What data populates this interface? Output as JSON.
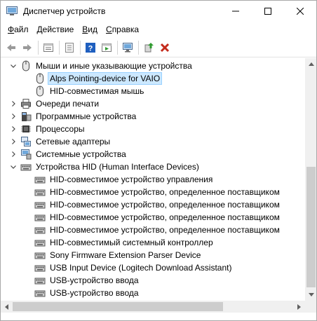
{
  "window": {
    "title": "Диспетчер устройств",
    "icon": "device-manager-icon"
  },
  "menu": [
    "Файл",
    "Действие",
    "Вид",
    "Справка"
  ],
  "toolbar": [
    "back-icon",
    "forward-icon",
    "properties-icon",
    "grid-icon",
    "help-icon",
    "run-icon",
    "monitor-icon",
    "update-driver-icon",
    "remove-device-icon"
  ],
  "tree": [
    {
      "label": "Мыши и иные указывающие устройства",
      "level": 1,
      "expanded": true,
      "icon": "mouse-icon"
    },
    {
      "label": "Alps Pointing-device for VAIO",
      "level": 2,
      "icon": "mouse-icon",
      "selected": true
    },
    {
      "label": "HID-совместимая мышь",
      "level": 2,
      "icon": "mouse-icon"
    },
    {
      "label": "Очереди печати",
      "level": 1,
      "expanded": false,
      "icon": "printer-icon"
    },
    {
      "label": "Программные устройства",
      "level": 1,
      "expanded": false,
      "icon": "software-device-icon"
    },
    {
      "label": "Процессоры",
      "level": 1,
      "expanded": false,
      "icon": "processor-icon"
    },
    {
      "label": "Сетевые адаптеры",
      "level": 1,
      "expanded": false,
      "icon": "network-adapter-icon"
    },
    {
      "label": "Системные устройства",
      "level": 1,
      "expanded": false,
      "icon": "system-device-icon"
    },
    {
      "label": "Устройства HID (Human Interface Devices)",
      "level": 1,
      "expanded": true,
      "icon": "hid-icon"
    },
    {
      "label": "HID-совместимое устройство управления",
      "level": 2,
      "icon": "hid-icon"
    },
    {
      "label": "HID-совместимое устройство, определенное поставщиком",
      "level": 2,
      "icon": "hid-icon"
    },
    {
      "label": "HID-совместимое устройство, определенное поставщиком",
      "level": 2,
      "icon": "hid-icon"
    },
    {
      "label": "HID-совместимое устройство, определенное поставщиком",
      "level": 2,
      "icon": "hid-icon"
    },
    {
      "label": "HID-совместимое устройство, определенное поставщиком",
      "level": 2,
      "icon": "hid-icon"
    },
    {
      "label": "HID-совместимый системный контроллер",
      "level": 2,
      "icon": "hid-icon"
    },
    {
      "label": "Sony Firmware Extension Parser Device",
      "level": 2,
      "icon": "hid-icon"
    },
    {
      "label": "USB Input Device (Logitech Download Assistant)",
      "level": 2,
      "icon": "hid-icon"
    },
    {
      "label": "USB-устройство ввода",
      "level": 2,
      "icon": "hid-icon"
    },
    {
      "label": "USB-устройство ввода",
      "level": 2,
      "icon": "hid-icon"
    }
  ],
  "colors": {
    "selection": "#cce8ff",
    "selection_border": "#99d1ff",
    "remove_red": "#c42b1c",
    "help_blue": "#1f5fbf"
  }
}
